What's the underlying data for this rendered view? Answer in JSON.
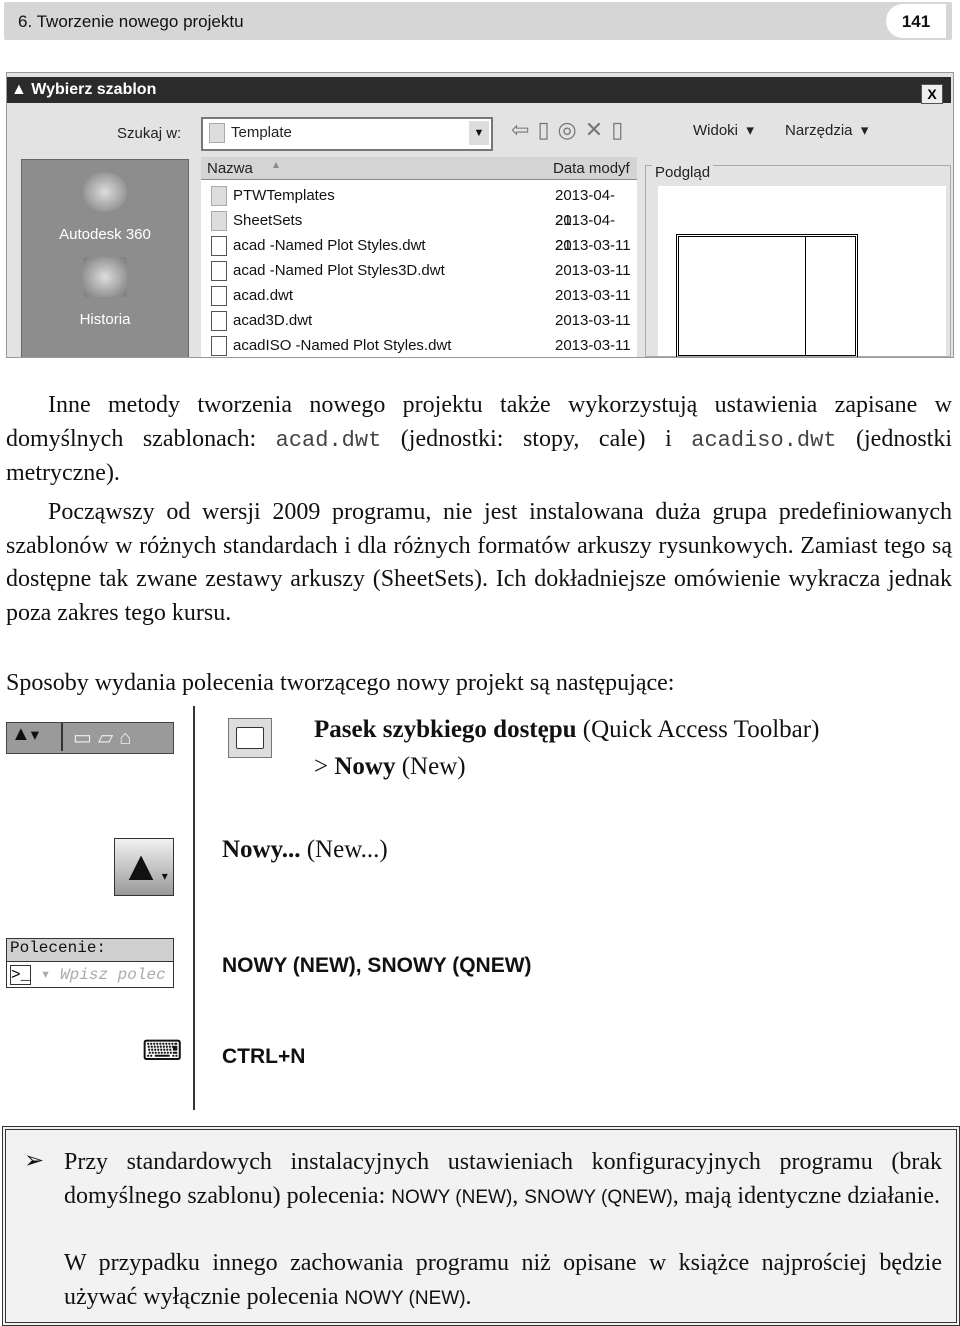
{
  "header": {
    "chapter": "6. Tworzenie nowego projektu",
    "page_number": "141"
  },
  "dialog": {
    "title": "Wybierz szablon",
    "close": "X",
    "look_in_label": "Szukaj w:",
    "look_in_value": "Template",
    "views": "Widoki",
    "tools": "Narzędzia",
    "places": [
      "Autodesk 360",
      "Historia"
    ],
    "columns": {
      "name": "Nazwa",
      "date": "Data modyf"
    },
    "files": [
      {
        "name": "PTWTemplates",
        "date": "2013-04-21",
        "type": "folder"
      },
      {
        "name": "SheetSets",
        "date": "2013-04-21",
        "type": "folder"
      },
      {
        "name": "acad -Named Plot Styles.dwt",
        "date": "2013-03-11",
        "type": "dwt"
      },
      {
        "name": "acad -Named Plot Styles3D.dwt",
        "date": "2013-03-11",
        "type": "dwt"
      },
      {
        "name": "acad.dwt",
        "date": "2013-03-11",
        "type": "dwt"
      },
      {
        "name": "acad3D.dwt",
        "date": "2013-03-11",
        "type": "dwt"
      },
      {
        "name": "acadISO -Named Plot Styles.dwt",
        "date": "2013-03-11",
        "type": "dwt"
      }
    ],
    "preview_label": "Podgląd"
  },
  "body": {
    "p1a": "Inne metody tworzenia nowego projektu także wykorzystują ustawienia zapisane w domyślnych szablonach: ",
    "p1_code1": "acad.dwt",
    "p1b": " (jednostki: stopy, cale) i ",
    "p1_code2": "acadiso.dwt",
    "p1c": " (jednostki metryczne).",
    "p2": "Począwszy od wersji 2009 programu, nie jest instalowana duża grupa predefiniowanych szablonów w różnych standardach i dla różnych formatów arkuszy rysunkowych. Zamiast tego są dostępne tak zwane zestawy arkuszy (SheetSets). Ich dokładniejsze omówienie wykracza jednak poza zakres tego kursu.",
    "p3": "Sposoby wydania polecenia tworzącego nowy projekt są następujące:"
  },
  "methods": {
    "qat_bold": "Pasek szybkiego dostępu",
    "qat_rest": " (Quick Access Toolbar)",
    "qat_gt": "> ",
    "qat_new_bold": "Nowy",
    "qat_new_rest": " (New)",
    "menu_bold": "Nowy...",
    "menu_rest": " (New...)",
    "cmd_label": "Polecenie:",
    "cmd_placeholder": "Wpisz polec",
    "cmd_text": "NOWY (NEW), SNOWY (QNEW)",
    "shortcut": "CTRL+N"
  },
  "note": {
    "a": "Przy standardowych instalacyjnych ustawieniach konfiguracyjnych programu (brak domyślnego szablonu) polecenia: ",
    "c1": "NOWY (NEW)",
    "sep": ", ",
    "c2": "SNOWY (QNEW)",
    "b": ", mają identyczne działanie.",
    "d": "W przypadku innego zachowania programu niż opisane w książce najprościej będzie używać wyłącznie polecenia ",
    "c3": "NOWY (NEW)",
    "e": "."
  }
}
